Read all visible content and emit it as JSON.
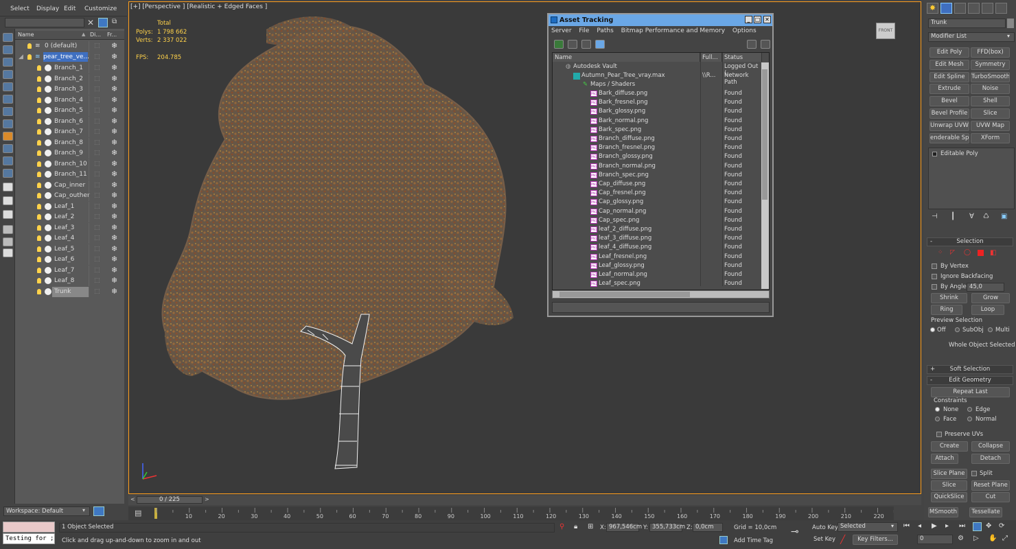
{
  "menu": {
    "select": "Select",
    "display": "Display",
    "edit": "Edit",
    "customize": "Customize"
  },
  "explorer": {
    "col_name": "Name",
    "col_display": "Di...",
    "col_freeze": "Fr...",
    "layer_default": "0 (default)",
    "layer_selected": "pear_tree_ve...",
    "objects": [
      "Branch_1",
      "Branch_2",
      "Branch_3",
      "Branch_4",
      "Branch_5",
      "Branch_6",
      "Branch_7",
      "Branch_8",
      "Branch_9",
      "Branch_10",
      "Branch_11",
      "Cap_inner",
      "Cap_outher",
      "Leaf_1",
      "Leaf_2",
      "Leaf_3",
      "Leaf_4",
      "Leaf_5",
      "Leaf_6",
      "Leaf_7",
      "Leaf_8",
      "Trunk"
    ],
    "workspace": "Workspace: Default"
  },
  "viewport": {
    "label": "[+] [Perspective ] [Realistic + Edged Faces ]",
    "stats_total": "Total",
    "polys_label": "Polys:",
    "polys_value": "1 798 662",
    "verts_label": "Verts:",
    "verts_value": "2 337 022",
    "fps_label": "FPS:",
    "fps_value": "204.785",
    "viewcube": "FRONT"
  },
  "asset_tracking": {
    "title": "Asset Tracking",
    "menu": [
      "Server",
      "File",
      "Paths",
      "Bitmap Performance and Memory",
      "Options"
    ],
    "col_name": "Name",
    "col_full": "Full...",
    "col_status": "Status",
    "vault": {
      "name": "Autodesk Vault",
      "status": "Logged Out (..."
    },
    "scene": {
      "name": "Autumn_Pear_Tree_vray.max",
      "full": "\\\\R...",
      "status": "Network Path"
    },
    "maps": "Maps / Shaders",
    "files": [
      {
        "name": "Bark_diffuse.png",
        "status": "Found"
      },
      {
        "name": "Bark_fresnel.png",
        "status": "Found"
      },
      {
        "name": "Bark_glossy.png",
        "status": "Found"
      },
      {
        "name": "Bark_normal.png",
        "status": "Found"
      },
      {
        "name": "Bark_spec.png",
        "status": "Found"
      },
      {
        "name": "Branch_diffuse.png",
        "status": "Found"
      },
      {
        "name": "Branch_fresnel.png",
        "status": "Found"
      },
      {
        "name": "Branch_glossy.png",
        "status": "Found"
      },
      {
        "name": "Branch_normal.png",
        "status": "Found"
      },
      {
        "name": "Branch_spec.png",
        "status": "Found"
      },
      {
        "name": "Cap_diffuse.png",
        "status": "Found"
      },
      {
        "name": "Cap_fresnel.png",
        "status": "Found"
      },
      {
        "name": "Cap_glossy.png",
        "status": "Found"
      },
      {
        "name": "Cap_normal.png",
        "status": "Found"
      },
      {
        "name": "Cap_spec.png",
        "status": "Found"
      },
      {
        "name": "leaf_2_diffuse.png",
        "status": "Found"
      },
      {
        "name": "leaf_3_diffuse.png",
        "status": "Found"
      },
      {
        "name": "leaf_4_diffuse.png",
        "status": "Found"
      },
      {
        "name": "Leaf_fresnel.png",
        "status": "Found"
      },
      {
        "name": "Leaf_glossy.png",
        "status": "Found"
      },
      {
        "name": "Leaf_normal.png",
        "status": "Found"
      },
      {
        "name": "Leaf_spec.png",
        "status": "Found"
      }
    ]
  },
  "command_panel": {
    "object_name": "Trunk",
    "modifier_list": "Modifier List",
    "modifiers": [
      "Edit Poly",
      "FFD(box)",
      "Edit Mesh",
      "Symmetry",
      "Edit Spline",
      "TurboSmooth",
      "Extrude",
      "Noise",
      "Bevel",
      "Shell",
      "Bevel Profile",
      "Slice",
      "Unwrap UVW",
      "UVW Map",
      "enderable Splin",
      "XForm"
    ],
    "stack_item": "Editable Poly",
    "selection": {
      "title": "Selection",
      "by_vertex": "By Vertex",
      "ignore_backfacing": "Ignore Backfacing",
      "by_angle": "By Angle:",
      "angle_value": "45,0",
      "shrink": "Shrink",
      "grow": "Grow",
      "ring": "Ring",
      "loop": "Loop",
      "preview": "Preview Selection",
      "off": "Off",
      "subobj": "SubObj",
      "multi": "Multi",
      "status": "Whole Object Selected"
    },
    "soft_selection": "Soft Selection",
    "edit_geometry": {
      "title": "Edit Geometry",
      "repeat_last": "Repeat Last",
      "constraints": "Constraints",
      "none": "None",
      "edge": "Edge",
      "face": "Face",
      "normal": "Normal",
      "preserve_uvs": "Preserve UVs",
      "create": "Create",
      "collapse": "Collapse",
      "attach": "Attach",
      "detach": "Detach",
      "slice_plane": "Slice Plane",
      "split": "Split",
      "slice": "Slice",
      "reset_plane": "Reset Plane",
      "quickslice": "QuickSlice",
      "cut": "Cut",
      "msmooth": "MSmooth",
      "tessellate": "Tessellate"
    }
  },
  "timeline": {
    "frame": "0 / 225",
    "ticks": [
      "10",
      "20",
      "30",
      "40",
      "50",
      "60",
      "70",
      "80",
      "90",
      "100",
      "110",
      "120",
      "130",
      "140",
      "150",
      "160",
      "170",
      "180",
      "190",
      "200",
      "210",
      "220"
    ]
  },
  "status_bar": {
    "maxscript": "Testing for ;",
    "selected": "1 Object Selected",
    "prompt": "Click and drag up-and-down to zoom in and out",
    "x_label": "X:",
    "x_value": "967,546cm",
    "y_label": "Y:",
    "y_value": "355,733cm",
    "z_label": "Z:",
    "z_value": "0,0cm",
    "grid": "Grid = 10,0cm",
    "add_time_tag": "Add Time Tag",
    "auto_key": "Auto Key",
    "set_key": "Set Key",
    "selected_dropdown": "Selected",
    "key_filters": "Key Filters...",
    "frame_field": "0"
  },
  "colors": {
    "accent": "#ff9e1b",
    "title_bar": "#6aa7e6",
    "selected_row": "#3f6fc0"
  }
}
